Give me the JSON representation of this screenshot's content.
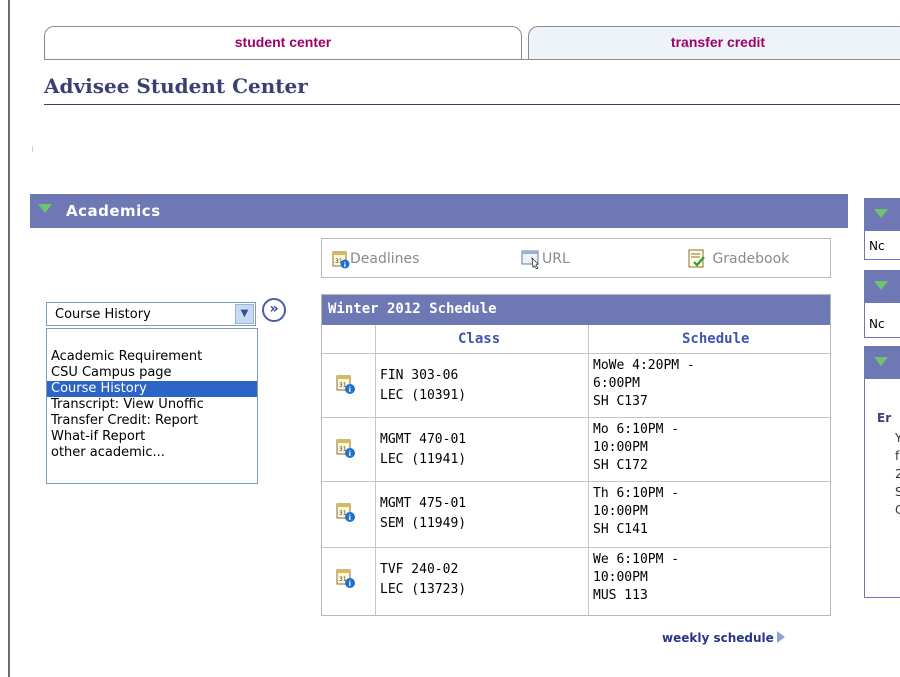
{
  "tabs": [
    {
      "label": "student center"
    },
    {
      "label": "transfer credit"
    }
  ],
  "page_title": "Advisee Student Center",
  "academics": {
    "header": "Academics",
    "toolbar": {
      "deadlines": "Deadlines",
      "url": "URL",
      "gradebook": "Gradebook"
    },
    "select": {
      "value": "Course History",
      "options": [
        "Academic Requirement",
        "CSU Campus page",
        "Course History",
        "Transcript: View Unoffic",
        "Transfer Credit: Report",
        "What-if Report",
        "other academic..."
      ],
      "highlighted_index": 2
    }
  },
  "schedule": {
    "title": "Winter 2012 Schedule",
    "columns": [
      "Class",
      "Schedule"
    ],
    "rows": [
      {
        "class_line1": "FIN 303-06",
        "class_line2": "LEC (10391)",
        "sched_line1": "MoWe 4:20PM -",
        "sched_line2": "6:00PM",
        "sched_line3": "SH C137"
      },
      {
        "class_line1": "MGMT 470-01",
        "class_line2": "LEC (11941)",
        "sched_line1": "Mo 6:10PM -",
        "sched_line2": "10:00PM",
        "sched_line3": "SH C172"
      },
      {
        "class_line1": "MGMT 475-01",
        "class_line2": "SEM (11949)",
        "sched_line1": "Th 6:10PM -",
        "sched_line2": "10:00PM",
        "sched_line3": "SH C141"
      },
      {
        "class_line1": "TVF 240-02",
        "class_line2": "LEC (13723)",
        "sched_line1": "We 6:10PM -",
        "sched_line2": "10:00PM",
        "sched_line3": "MUS 113"
      }
    ],
    "weekly_link": "weekly schedule"
  },
  "right_panels": {
    "panel1_text": "Nc",
    "panel2_text": "Nc",
    "panel3_fragments": [
      "Er",
      "Y",
      "f",
      "2",
      "S",
      "C"
    ]
  },
  "colors": {
    "header_bg": "#6d78b4",
    "tab_text": "#a0006a",
    "title": "#3a3f76",
    "selection": "#2c64c8"
  }
}
